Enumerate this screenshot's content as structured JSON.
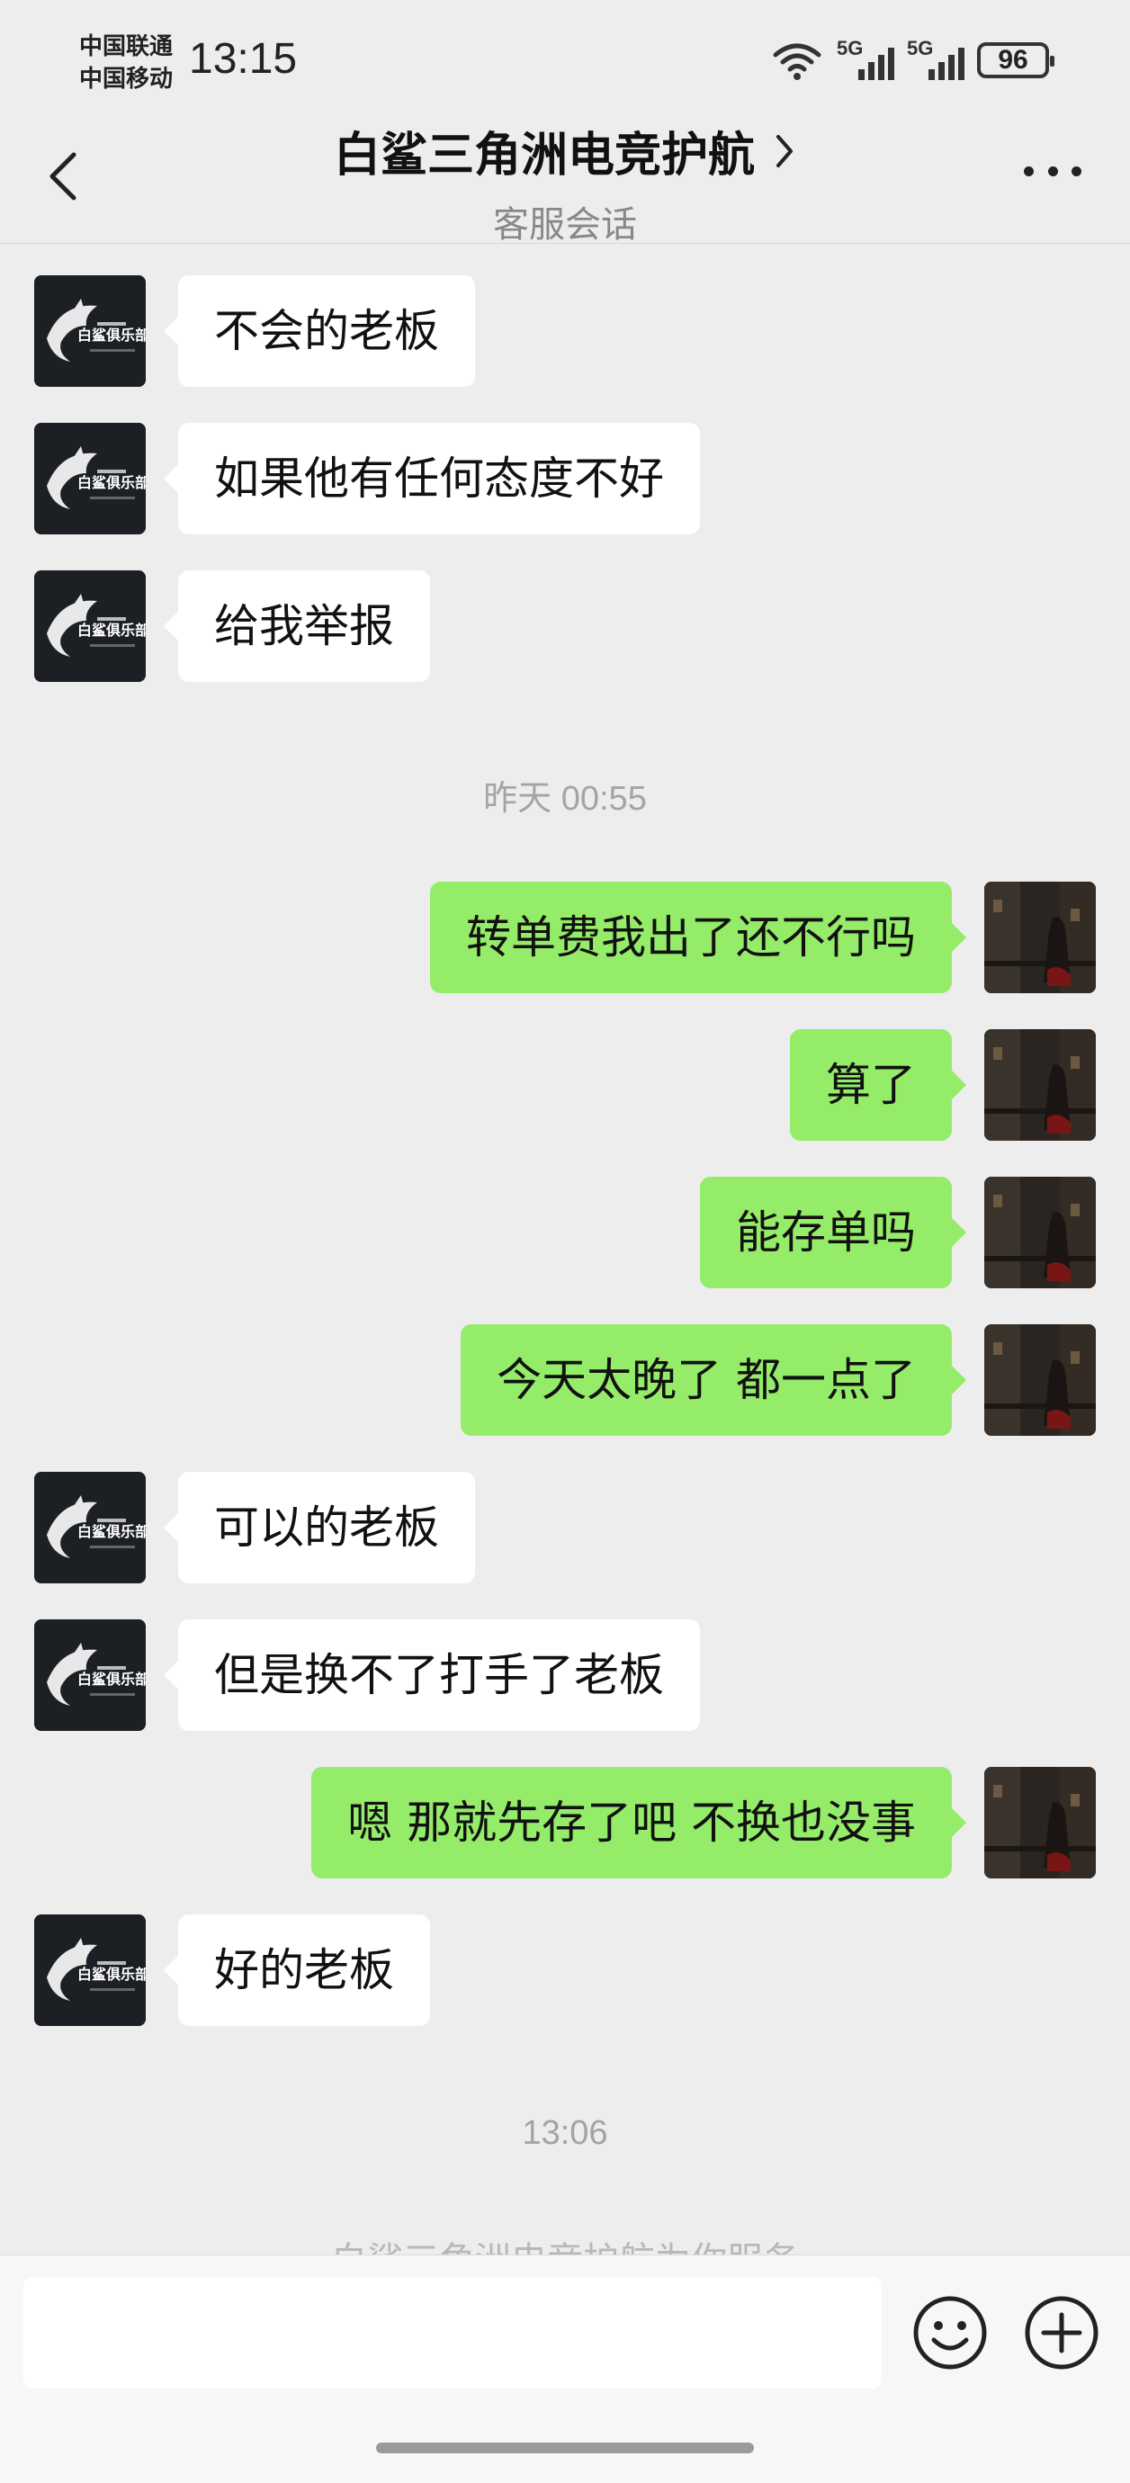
{
  "status_bar": {
    "carrier_1": "中国联通",
    "carrier_2": "中国移动",
    "time": "13:15",
    "signal_1_label": "5G",
    "signal_2_label": "5G",
    "battery": "96"
  },
  "header": {
    "title": "白鲨三角洲电竞护航",
    "subtitle": "客服会话"
  },
  "messages": [
    {
      "side": "in",
      "text": "不会的老板"
    },
    {
      "side": "in",
      "text": "如果他有任何态度不好"
    },
    {
      "side": "in",
      "text": "给我举报"
    },
    {
      "side": "time",
      "text": "昨天 00:55"
    },
    {
      "side": "out",
      "text": "转单费我出了还不行吗"
    },
    {
      "side": "out",
      "text": "算了"
    },
    {
      "side": "out",
      "text": "能存单吗"
    },
    {
      "side": "out",
      "text": "今天太晚了  都一点了"
    },
    {
      "side": "in",
      "text": "可以的老板"
    },
    {
      "side": "in",
      "text": "但是换不了打手了老板"
    },
    {
      "side": "out",
      "text": "嗯 那就先存了吧 不换也没事"
    },
    {
      "side": "in",
      "text": "好的老板"
    },
    {
      "side": "time",
      "text": "13:06"
    }
  ],
  "footer_note": "白鲨三角洲电竞护航为你服务",
  "input": {
    "value": "",
    "placeholder": ""
  },
  "icons": {
    "back": "chevron-left-icon",
    "more": "more-dots-icon",
    "emoji": "emoji-icon",
    "plus": "plus-icon"
  },
  "colors": {
    "background": "#ededed",
    "incoming_bubble": "#ffffff",
    "outgoing_bubble": "#95ec69",
    "timestamp": "#a4a4a4"
  }
}
